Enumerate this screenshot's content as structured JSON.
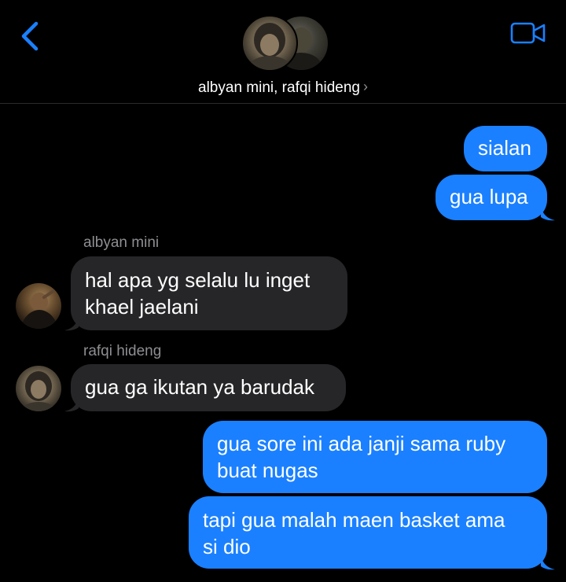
{
  "header": {
    "back_icon": "chevron-left-icon",
    "video_icon": "video-camera-icon",
    "group_name": "albyan mini, rafqi hideng",
    "chevron": "›"
  },
  "colors": {
    "accent": "#1a80ff",
    "incoming_bubble": "#262628",
    "sender_label": "#8e8e93",
    "background": "#000000"
  },
  "messages": [
    {
      "direction": "outgoing",
      "text": "sialan"
    },
    {
      "direction": "outgoing",
      "text": "gua lupa"
    },
    {
      "direction": "incoming",
      "sender": "albyan mini",
      "lines": [
        "hal apa yg selalu lu inget",
        "khael jaelani"
      ]
    },
    {
      "direction": "incoming",
      "sender": "rafqi hideng",
      "text": "gua ga ikutan ya barudak"
    },
    {
      "direction": "outgoing",
      "lines": [
        "gua sore ini ada janji sama ruby",
        "buat nugas"
      ]
    },
    {
      "direction": "outgoing",
      "lines": [
        "tapi gua malah maen basket ama",
        "si dio"
      ]
    }
  ]
}
